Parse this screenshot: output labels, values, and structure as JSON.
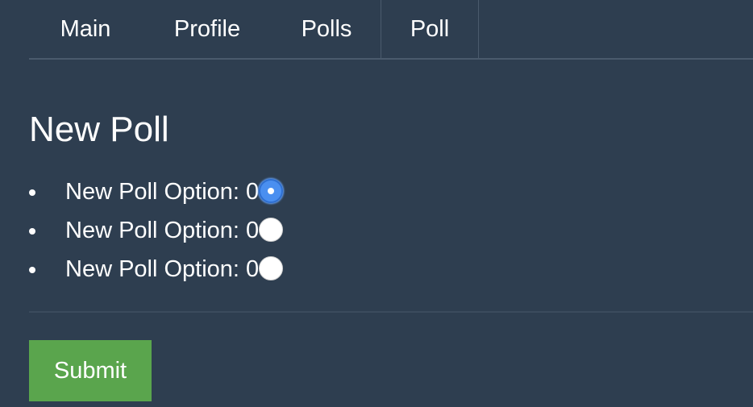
{
  "nav": {
    "items": [
      {
        "label": "Main"
      },
      {
        "label": "Profile"
      },
      {
        "label": "Polls"
      },
      {
        "label": "Poll"
      }
    ],
    "active": "Poll"
  },
  "poll": {
    "title": "New Poll",
    "options": [
      {
        "label": "New Poll Option: 0",
        "selected": true
      },
      {
        "label": "New Poll Option: 0",
        "selected": false
      },
      {
        "label": "New Poll Option: 0",
        "selected": false
      }
    ]
  },
  "submit_label": "Submit",
  "colors": {
    "background": "#2e3e50",
    "submit": "#5aa54d",
    "radio_selected": "#4a8ff0"
  }
}
